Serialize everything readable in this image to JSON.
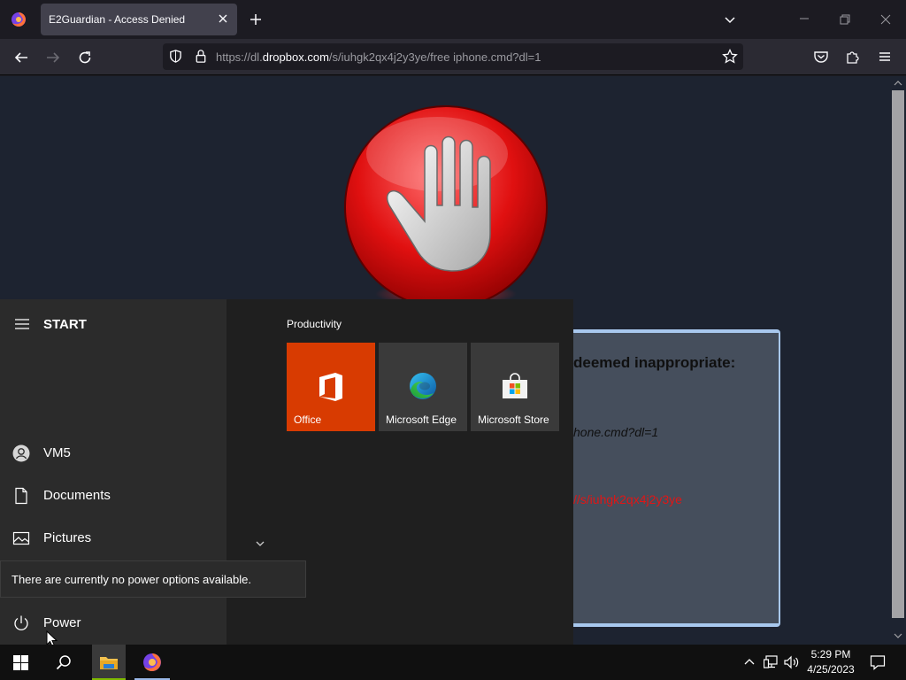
{
  "browser": {
    "tab": {
      "title": "E2Guardian - Access Denied"
    },
    "url": {
      "prefix": "https://dl.",
      "domain": "dropbox.com",
      "path": "/s/iuhgk2qx4j2y3ye/free iphone.cmd?dl=1"
    }
  },
  "page": {
    "heading_fragment": "deemed inappropriate:",
    "url_fragment": "hone.cmd?dl=1",
    "red_fragment": "//s/iuhgk2qx4j2y3ye"
  },
  "start_menu": {
    "title": "START",
    "user": "VM5",
    "items": [
      {
        "label": "Documents",
        "icon": "document-icon"
      },
      {
        "label": "Pictures",
        "icon": "pictures-icon"
      }
    ],
    "power_label": "Power",
    "tooltip": "There are currently no power options available.",
    "group_label": "Productivity",
    "tiles": [
      {
        "label": "Office",
        "icon": "office-icon",
        "color": "#d83b01"
      },
      {
        "label": "Microsoft Edge",
        "icon": "edge-icon",
        "color": "#3a3a3a"
      },
      {
        "label": "Microsoft Store",
        "icon": "store-icon",
        "color": "#3a3a3a"
      }
    ]
  },
  "taskbar": {
    "time": "5:29 PM",
    "date": "4/25/2023"
  },
  "colors": {
    "accent_red": "#e01616",
    "office_orange": "#d83b01",
    "card_border": "#a8c8ee"
  }
}
